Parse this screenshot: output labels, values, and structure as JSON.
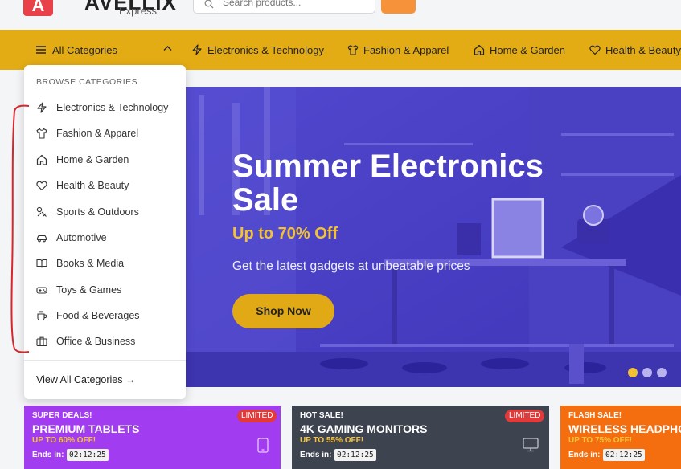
{
  "header": {
    "logo_letter": "A",
    "logo_name": "AVELLIX",
    "logo_sub": "Express",
    "search_placeholder": "Search products..."
  },
  "nav": {
    "all_categories": "All Categories",
    "items": [
      {
        "label": "Electronics & Technology",
        "icon": "bolt-icon"
      },
      {
        "label": "Fashion & Apparel",
        "icon": "shirt-icon"
      },
      {
        "label": "Home & Garden",
        "icon": "home-icon"
      },
      {
        "label": "Health & Beauty",
        "icon": "heart-icon"
      }
    ]
  },
  "dropdown": {
    "title": "BROWSE CATEGORIES",
    "items": [
      {
        "label": "Electronics & Technology",
        "icon": "bolt-icon"
      },
      {
        "label": "Fashion & Apparel",
        "icon": "shirt-icon"
      },
      {
        "label": "Home & Garden",
        "icon": "home-icon"
      },
      {
        "label": "Health & Beauty",
        "icon": "heart-icon"
      },
      {
        "label": "Sports & Outdoors",
        "icon": "sports-icon"
      },
      {
        "label": "Automotive",
        "icon": "car-icon"
      },
      {
        "label": "Books & Media",
        "icon": "book-icon"
      },
      {
        "label": "Toys & Games",
        "icon": "gamepad-icon"
      },
      {
        "label": "Food & Beverages",
        "icon": "cup-icon"
      },
      {
        "label": "Office & Business",
        "icon": "briefcase-icon"
      }
    ],
    "view_all": "View All Categories →"
  },
  "hero": {
    "title": "Summer Electronics Sale",
    "subtitle": "Up to 70% Off",
    "description": "Get the latest gadgets at unbeatable prices",
    "button": "Shop Now",
    "active_slide": 1,
    "slide_count": 3
  },
  "deals": [
    {
      "tag": "SUPER DEALS!",
      "name": "PREMIUM TABLETS",
      "off": "UP TO 60% OFF!",
      "ends_label": "Ends in:",
      "timer": "02:12:25",
      "badge": "LIMITED",
      "icon": "tablet-icon",
      "color": "#a23cf0"
    },
    {
      "tag": "HOT SALE!",
      "name": "4K GAMING MONITORS",
      "off": "UP TO 55% OFF!",
      "ends_label": "Ends in:",
      "timer": "02:12:25",
      "badge": "LIMITED",
      "icon": "monitor-icon",
      "color": "#3e4350"
    },
    {
      "tag": "FLASH SALE!",
      "name": "WIRELESS HEADPHONES",
      "off": "UP TO 75% OFF!",
      "ends_label": "Ends in:",
      "timer": "02:12:25",
      "badge": "",
      "icon": "",
      "color": "#f46d0f"
    }
  ],
  "colors": {
    "nav_bg": "#e4ac14",
    "hero_bg": "#4b43c8",
    "accent_yellow": "#f2c232",
    "logo_red": "#e8414a",
    "search_btn": "#f6923a",
    "annotation_red": "#d7262c"
  }
}
